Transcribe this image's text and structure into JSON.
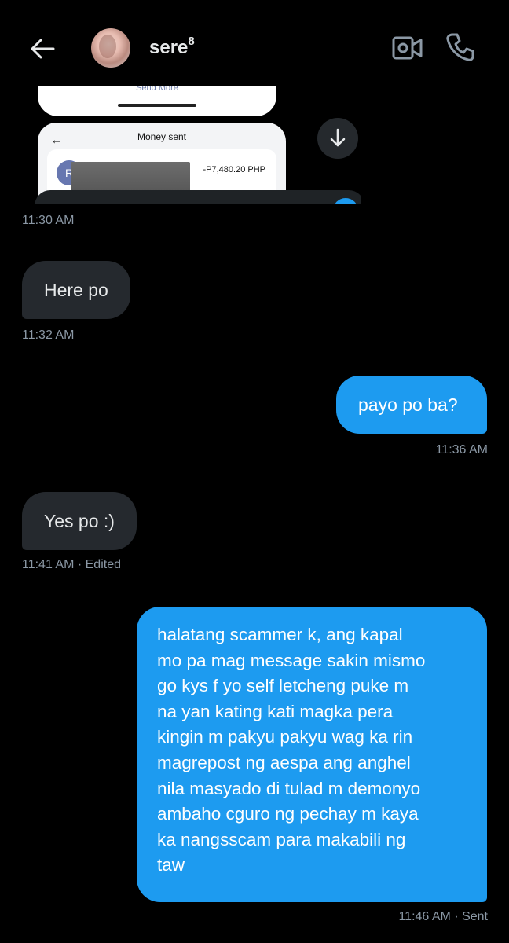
{
  "header": {
    "contact_name": "sere",
    "contact_name_sup": "8"
  },
  "attachment": {
    "send_more_label": "Send More",
    "screen_title": "Money sent",
    "recipient_initial": "R",
    "amount": "-P7,480.20 PHP"
  },
  "messages": [
    {
      "direction": "in",
      "time": "11:30 AM"
    },
    {
      "direction": "in",
      "text": "Here po",
      "time": "11:32 AM"
    },
    {
      "direction": "out",
      "text": "payo po ba?",
      "time": "11:36 AM"
    },
    {
      "direction": "in",
      "text": "Yes po :)",
      "time": "11:41 AM · Edited"
    },
    {
      "direction": "out",
      "text": "halatang scammer k, ang kapal\nmo pa mag message sakin mismo\ngo kys f yo self letcheng puke m\nna yan kating kati magka pera\nkingin m pakyu pakyu wag ka rin\nmagrepost ng aespa ang anghel\nnila masyado  di tulad m demonyo\nambaho cguro ng pechay m kaya\nka nangsscam para makabili ng\ntaw",
      "time": "11:46 AM · Sent"
    }
  ],
  "icons": {
    "back": "arrow-left-icon",
    "video": "video-camera-icon",
    "call": "phone-icon",
    "scroll": "arrow-down-icon"
  },
  "colors": {
    "background": "#000000",
    "incoming_bubble": "#25292e",
    "outgoing_bubble": "#1d9bf0",
    "timestamp": "#8b98a5"
  }
}
